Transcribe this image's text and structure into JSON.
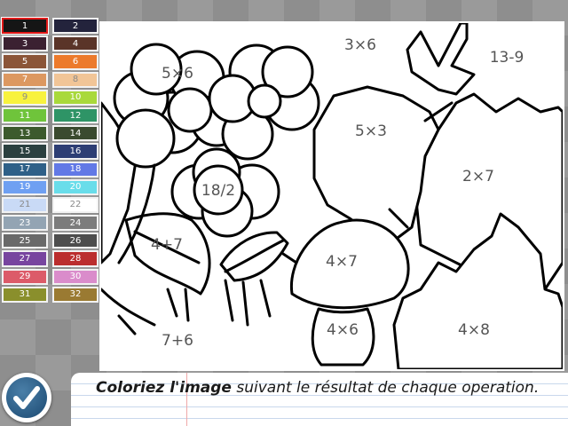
{
  "palette": {
    "selected": "1",
    "swatches": [
      {
        "label": "1",
        "color": "#151515"
      },
      {
        "label": "2",
        "color": "#23233c"
      },
      {
        "label": "3",
        "color": "#3b2131"
      },
      {
        "label": "4",
        "color": "#5a3428"
      },
      {
        "label": "5",
        "color": "#8b5538"
      },
      {
        "label": "6",
        "color": "#ec7a2c"
      },
      {
        "label": "7",
        "color": "#dc9860"
      },
      {
        "label": "8",
        "color": "#f1c597"
      },
      {
        "label": "9",
        "color": "#f8f23e"
      },
      {
        "label": "10",
        "color": "#a9d93b"
      },
      {
        "label": "11",
        "color": "#6fc43b"
      },
      {
        "label": "12",
        "color": "#2e9466"
      },
      {
        "label": "13",
        "color": "#3c5a2d"
      },
      {
        "label": "14",
        "color": "#3a4a2f"
      },
      {
        "label": "15",
        "color": "#2b4040"
      },
      {
        "label": "16",
        "color": "#2d3e74"
      },
      {
        "label": "17",
        "color": "#2f6088"
      },
      {
        "label": "18",
        "color": "#6279e6"
      },
      {
        "label": "19",
        "color": "#6fa0f2"
      },
      {
        "label": "20",
        "color": "#69ddea"
      },
      {
        "label": "21",
        "color": "#c9daf6"
      },
      {
        "label": "22",
        "color": "#ffffff"
      },
      {
        "label": "23",
        "color": "#93a4b3"
      },
      {
        "label": "24",
        "color": "#7c7c7c"
      },
      {
        "label": "25",
        "color": "#6a6a6a"
      },
      {
        "label": "26",
        "color": "#4d4d4d"
      },
      {
        "label": "27",
        "color": "#78459f"
      },
      {
        "label": "28",
        "color": "#bb2e2e"
      },
      {
        "label": "29",
        "color": "#dc5b69"
      },
      {
        "label": "30",
        "color": "#da8ccb"
      },
      {
        "label": "31",
        "color": "#8a8f2c"
      },
      {
        "label": "32",
        "color": "#9a7a32"
      }
    ]
  },
  "regions": {
    "r1": "5×6",
    "r2": "3×6",
    "r3": "13-9",
    "r4": "5×3",
    "r5": "18/2",
    "r6": "2×7",
    "r7": "4+7",
    "r8": "4×7",
    "r9": "7+6",
    "r10": "4×6",
    "r11": "4×8"
  },
  "instruction": {
    "bold": "Coloriez l'image",
    "rest": " suivant le résultat de chaque operation."
  },
  "icons": {
    "check": "check-icon"
  }
}
